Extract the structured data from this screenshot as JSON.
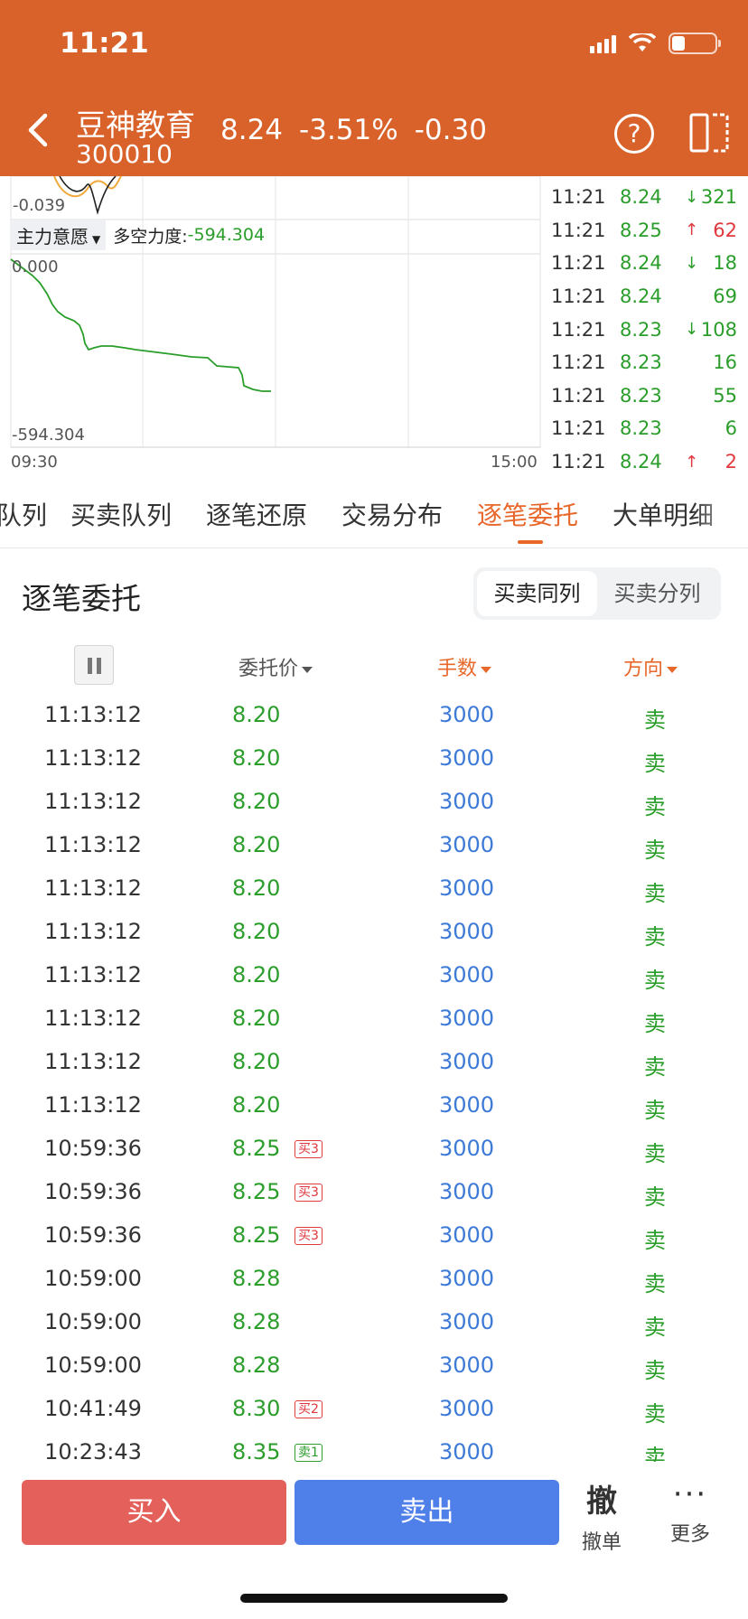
{
  "status": {
    "time": "11:21"
  },
  "stock": {
    "name": "豆神教育",
    "code": "300010",
    "price": "8.24",
    "change_pct": "-3.51%",
    "change": "-0.30"
  },
  "chart": {
    "upper_label": "-0.039",
    "indicator_name": "主力意愿",
    "indicator_label": "多空力度:",
    "indicator_value": "-594.304",
    "y_top": "0.000",
    "y_bottom": "-594.304",
    "x_start": "09:30",
    "x_end": "15:00"
  },
  "ticks": [
    {
      "time": "11:21",
      "price": "8.24",
      "arrow": "↓",
      "vol": "321",
      "dir": "down"
    },
    {
      "time": "11:21",
      "price": "8.25",
      "arrow": "↑",
      "vol": "62",
      "dir": "up"
    },
    {
      "time": "11:21",
      "price": "8.24",
      "arrow": "↓",
      "vol": "18",
      "dir": "down"
    },
    {
      "time": "11:21",
      "price": "8.24",
      "arrow": "",
      "vol": "69",
      "dir": "down"
    },
    {
      "time": "11:21",
      "price": "8.23",
      "arrow": "↓",
      "vol": "108",
      "dir": "down"
    },
    {
      "time": "11:21",
      "price": "8.23",
      "arrow": "",
      "vol": "16",
      "dir": "down"
    },
    {
      "time": "11:21",
      "price": "8.23",
      "arrow": "",
      "vol": "55",
      "dir": "down"
    },
    {
      "time": "11:21",
      "price": "8.23",
      "arrow": "",
      "vol": "6",
      "dir": "down"
    },
    {
      "time": "11:21",
      "price": "8.24",
      "arrow": "↑",
      "vol": "2",
      "dir": "up"
    }
  ],
  "tabs": [
    "队列",
    "买卖队列",
    "逐笔还原",
    "交易分布",
    "逐笔委托",
    "大单明细"
  ],
  "section": {
    "title": "逐笔委托",
    "seg_same": "买卖同列",
    "seg_split": "买卖分列"
  },
  "table_header": {
    "price": "委托价",
    "qty": "手数",
    "dir": "方向"
  },
  "orders": [
    {
      "time": "11:13:12",
      "price": "8.20",
      "tag": "",
      "qty": "3000",
      "dir": "卖"
    },
    {
      "time": "11:13:12",
      "price": "8.20",
      "tag": "",
      "qty": "3000",
      "dir": "卖"
    },
    {
      "time": "11:13:12",
      "price": "8.20",
      "tag": "",
      "qty": "3000",
      "dir": "卖"
    },
    {
      "time": "11:13:12",
      "price": "8.20",
      "tag": "",
      "qty": "3000",
      "dir": "卖"
    },
    {
      "time": "11:13:12",
      "price": "8.20",
      "tag": "",
      "qty": "3000",
      "dir": "卖"
    },
    {
      "time": "11:13:12",
      "price": "8.20",
      "tag": "",
      "qty": "3000",
      "dir": "卖"
    },
    {
      "time": "11:13:12",
      "price": "8.20",
      "tag": "",
      "qty": "3000",
      "dir": "卖"
    },
    {
      "time": "11:13:12",
      "price": "8.20",
      "tag": "",
      "qty": "3000",
      "dir": "卖"
    },
    {
      "time": "11:13:12",
      "price": "8.20",
      "tag": "",
      "qty": "3000",
      "dir": "卖"
    },
    {
      "time": "11:13:12",
      "price": "8.20",
      "tag": "",
      "qty": "3000",
      "dir": "卖"
    },
    {
      "time": "10:59:36",
      "price": "8.25",
      "tag": "买3",
      "tag_type": "buy",
      "qty": "3000",
      "dir": "卖"
    },
    {
      "time": "10:59:36",
      "price": "8.25",
      "tag": "买3",
      "tag_type": "buy",
      "qty": "3000",
      "dir": "卖"
    },
    {
      "time": "10:59:36",
      "price": "8.25",
      "tag": "买3",
      "tag_type": "buy",
      "qty": "3000",
      "dir": "卖"
    },
    {
      "time": "10:59:00",
      "price": "8.28",
      "tag": "",
      "qty": "3000",
      "dir": "卖"
    },
    {
      "time": "10:59:00",
      "price": "8.28",
      "tag": "",
      "qty": "3000",
      "dir": "卖"
    },
    {
      "time": "10:59:00",
      "price": "8.28",
      "tag": "",
      "qty": "3000",
      "dir": "卖"
    },
    {
      "time": "10:41:49",
      "price": "8.30",
      "tag": "买2",
      "tag_type": "buy",
      "qty": "3000",
      "dir": "卖"
    },
    {
      "time": "10:23:43",
      "price": "8.35",
      "tag": "卖1",
      "tag_type": "sell",
      "qty": "3000",
      "dir": "卖"
    }
  ],
  "bottom": {
    "buy": "买入",
    "sell": "卖出",
    "cancel_glyph": "撤",
    "cancel": "撤单",
    "more_glyph": "···",
    "more": "更多"
  },
  "colors": {
    "header": "#d9612a",
    "accent": "#e8672b",
    "green": "#2a9d2a",
    "red": "#e0383e",
    "blue": "#3d7ad6",
    "buy_btn": "#e4605a",
    "sell_btn": "#4f7fe8"
  }
}
